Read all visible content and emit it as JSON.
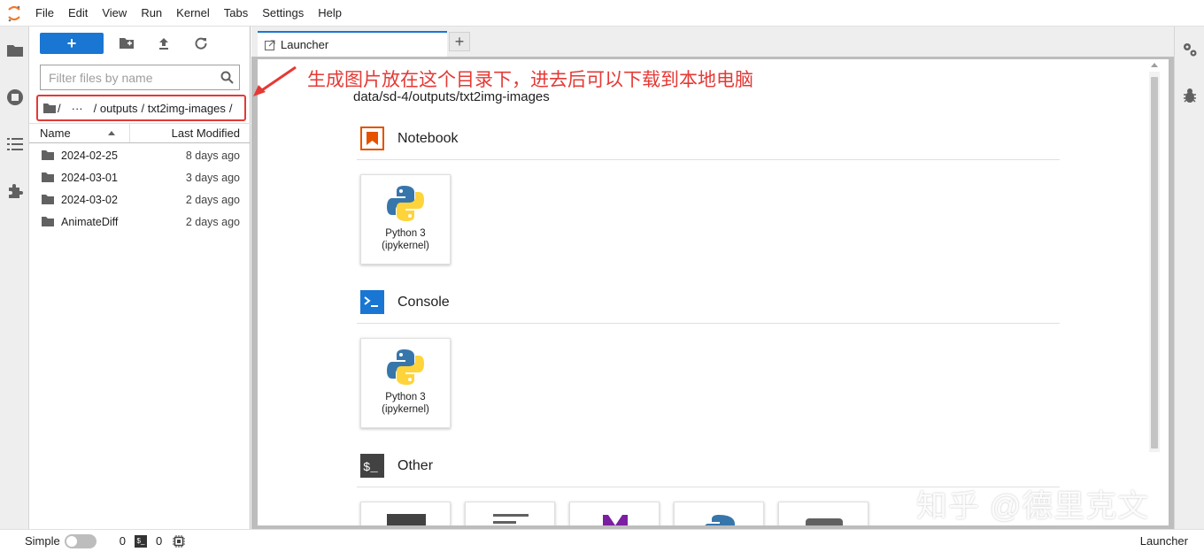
{
  "menu": [
    "File",
    "Edit",
    "View",
    "Run",
    "Kernel",
    "Tabs",
    "Settings",
    "Help"
  ],
  "filebrowser": {
    "new_label": "+",
    "filter_placeholder": "Filter files by name",
    "breadcrumbs": [
      "/",
      "···",
      "/ outputs",
      "/ txt2img-images",
      "/"
    ],
    "columns": {
      "name": "Name",
      "modified": "Last Modified"
    },
    "files": [
      {
        "name": "2024-02-25",
        "modified": "8 days ago"
      },
      {
        "name": "2024-03-01",
        "modified": "3 days ago"
      },
      {
        "name": "2024-03-02",
        "modified": "2 days ago"
      },
      {
        "name": "AnimateDiff",
        "modified": "2 days ago"
      }
    ]
  },
  "tabs": {
    "active": "Launcher",
    "add": "+"
  },
  "launcher": {
    "cwd": "data/sd-4/outputs/txt2img-images",
    "sections": {
      "notebook": "Notebook",
      "console": "Console",
      "other": "Other"
    },
    "kernel_card": {
      "line1": "Python 3",
      "line2": "(ipykernel)"
    }
  },
  "annotation": "生成图片放在这个目录下，进去后可以下载到本地电脑",
  "statusbar": {
    "simple_label": "Simple",
    "kernels_count": "0",
    "terminal_icon_text": "$_",
    "terminals_count": "0",
    "right_label": "Launcher"
  },
  "watermark": "知乎 @德里克文",
  "colors": {
    "accent": "#1976d2",
    "annotation": "#e53935",
    "notebook_icon": "#e65100",
    "console_icon": "#1976d2"
  },
  "icons": {
    "activity": [
      "folder-icon",
      "running-icon",
      "toc-icon",
      "extension-icon"
    ],
    "right": [
      "property-inspector-icon",
      "debugger-icon"
    ]
  }
}
